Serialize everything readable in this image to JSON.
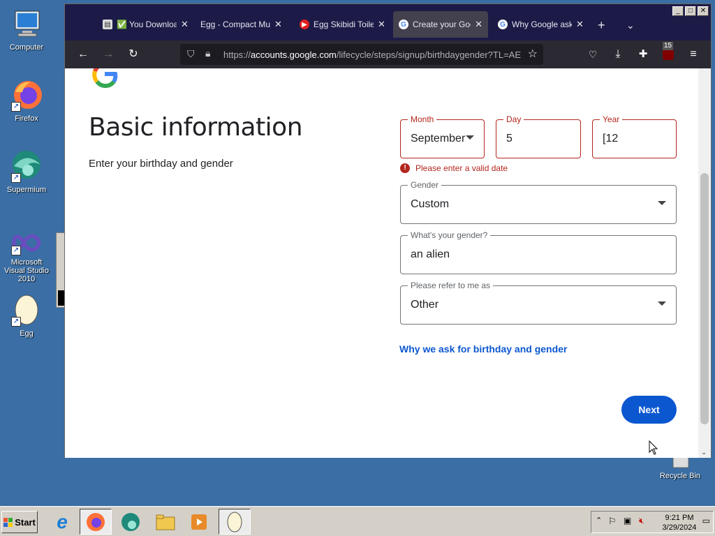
{
  "desktop": {
    "icons": [
      {
        "label": "Computer"
      },
      {
        "label": "Firefox"
      },
      {
        "label": "Supermium"
      },
      {
        "label": "Microsoft Visual Studio 2010"
      },
      {
        "label": "Egg"
      },
      {
        "label": "Recycle Bin"
      }
    ]
  },
  "browser": {
    "tabs": [
      {
        "label": "✅ You Download",
        "icon": "document-icon"
      },
      {
        "label": "Egg - Compact Multifu",
        "icon": "none"
      },
      {
        "label": "Egg Skibidi Toilet",
        "icon": "youtube-icon"
      },
      {
        "label": "Create your Goo",
        "icon": "google-icon",
        "active": true
      },
      {
        "label": "Why Google ask",
        "icon": "google-icon"
      }
    ],
    "url_domain": "accounts.google.com",
    "url_prefix": "https://",
    "url_path": "/lifecycle/steps/signup/birthdaygender?TL=AE",
    "extension_badge": "15"
  },
  "page": {
    "title": "Basic information",
    "subtitle": "Enter your birthday and gender",
    "month": {
      "label": "Month",
      "value": "September"
    },
    "day": {
      "label": "Day",
      "value": "5"
    },
    "year": {
      "label": "Year",
      "value": "[12"
    },
    "error": "Please enter a valid date",
    "gender": {
      "label": "Gender",
      "value": "Custom"
    },
    "custom_gender": {
      "label": "What's your gender?",
      "value": "an alien"
    },
    "pronoun": {
      "label": "Please refer to me as",
      "value": "Other"
    },
    "why_link": "Why we ask for birthday and gender",
    "next_label": "Next",
    "accent_color": "#0b57d0",
    "error_color": "#b3261e"
  },
  "taskbar": {
    "start_label": "Start",
    "time": "9:21 PM",
    "date": "3/29/2024"
  }
}
